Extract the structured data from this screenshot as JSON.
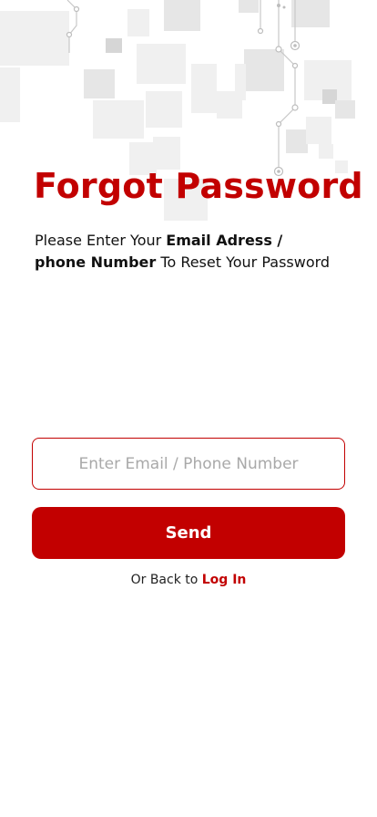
{
  "screen": {
    "title": "Forgot Password",
    "subtitle_prefix": "Please Enter Your ",
    "subtitle_bold_1": "Email Adress /",
    "subtitle_bold_2": "phone Number",
    "subtitle_suffix": " To Reset Your Password"
  },
  "form": {
    "identifier_placeholder": "Enter Email / Phone Number",
    "identifier_value": "",
    "send_label": "Send"
  },
  "footer": {
    "back_text": "Or Back to ",
    "login_label": "Log In"
  },
  "colors": {
    "accent": "#c20000",
    "placeholder": "#a9a9a9",
    "background": "#ffffff"
  }
}
